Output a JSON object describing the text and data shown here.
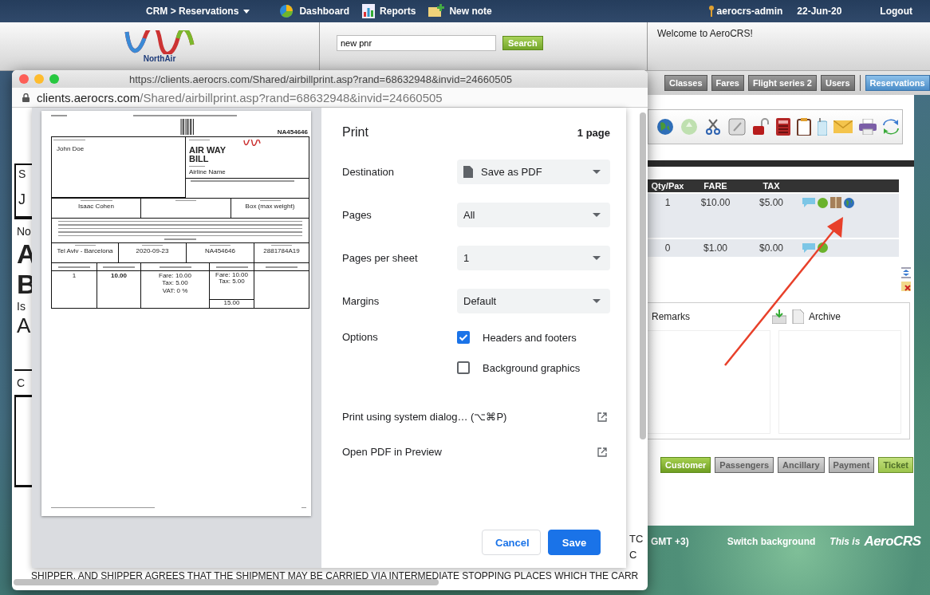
{
  "top_bar": {
    "menu": "CRM > Reservations",
    "links": [
      {
        "label": "Dashboard",
        "kind": "dashboard"
      },
      {
        "label": "Reports",
        "kind": "reports"
      },
      {
        "label": "New note",
        "kind": "note"
      }
    ],
    "user": "aerocrs-admin",
    "date": "22-Jun-20",
    "logout": "Logout"
  },
  "header": {
    "logo": "NorthAir",
    "search": {
      "value": "new pnr",
      "button": "Search"
    },
    "welcome": "Welcome to AeroCRS!"
  },
  "app": {
    "nav_tabs": [
      {
        "label": "Classes",
        "selected": false
      },
      {
        "label": "Fares",
        "selected": false
      },
      {
        "label": "Flight series 2",
        "selected": false
      },
      {
        "label": "Users",
        "selected": false
      },
      {
        "label": "Reservations",
        "selected": true
      }
    ],
    "table": {
      "columns": [
        "Qty/Pax",
        "FARE",
        "TAX"
      ],
      "rows": [
        {
          "kind": "cargo",
          "cells": [
            "1",
            "$10.00",
            "$5.00"
          ]
        },
        {
          "kind": "plain",
          "cells": [
            "0",
            "$1.00",
            "$0.00"
          ]
        }
      ]
    },
    "remarks": "Remarks",
    "archive": "Archive",
    "steps": [
      {
        "label": "Customer",
        "active": true,
        "disabled": false
      },
      {
        "label": "Passengers",
        "active": false,
        "disabled": true
      },
      {
        "label": "Ancillary",
        "active": false,
        "disabled": true
      },
      {
        "label": "Payment",
        "active": false,
        "disabled": true
      },
      {
        "label": "Ticket",
        "active": false,
        "disabled": false
      }
    ],
    "footer": {
      "timezone": "GMT +3)",
      "switch": "Switch background",
      "brand_prefix": "This is",
      "brand": "AeroCRS"
    }
  },
  "browser": {
    "title": "https://clients.aerocrs.com/Shared/airbillprint.asp?rand=68632948&invid=24660505",
    "address_host": "clients.aerocrs.com",
    "address_path": "/Shared/airbillprint.asp?rand=68632948&invid=24660505",
    "behind_page": {
      "left_fragments": [
        {
          "text": "S",
          "kind": "small"
        },
        {
          "text": "J",
          "kind": "text"
        },
        {
          "text": "No",
          "kind": "small"
        },
        {
          "text": "A",
          "kind": "heading"
        },
        {
          "text": "B",
          "kind": "heading"
        },
        {
          "text": "Is",
          "kind": "small"
        },
        {
          "text": "A",
          "kind": "large"
        },
        {
          "text": "C",
          "kind": "small"
        }
      ],
      "right_fragments": [
        "TC",
        "C"
      ],
      "bottom_line": "SHIPPER, AND SHIPPER AGREES THAT THE SHIPMENT MAY BE CARRIED VIA INTERMEDIATE STOPPING PLACES WHICH THE CARR"
    }
  },
  "print_dialog": {
    "title": "Print",
    "page_count": "1 page",
    "settings": [
      {
        "label": "Destination",
        "kind": "destination",
        "value": "Save as PDF"
      },
      {
        "label": "Pages",
        "kind": "select",
        "value": "All"
      },
      {
        "label": "Pages per sheet",
        "kind": "select",
        "value": "1"
      },
      {
        "label": "Margins",
        "kind": "select",
        "value": "Default"
      }
    ],
    "options_label": "Options",
    "options": [
      {
        "label": "Headers and footers",
        "checked": true
      },
      {
        "label": "Background graphics",
        "checked": false
      }
    ],
    "links": [
      "Print using system dialog… (⌥⌘P)",
      "Open PDF in Preview"
    ],
    "cancel": "Cancel",
    "save": "Save",
    "preview": {
      "number": "NA454646",
      "shipper": "John Doe",
      "title": "AIR WAY BILL",
      "airline": "Airline Name",
      "consignee": "Isaac Cohen",
      "package_type": "Box (max weight)",
      "route": [
        "Tel Aviv - Barcelona",
        "2020-09-23",
        "NA454646",
        "2881784A19"
      ],
      "pieces": "1",
      "weight": "10.00",
      "rate": [
        "Fare: 10.00",
        "Tax: 5.00",
        "VAT: 0 %"
      ],
      "total": [
        "Fare: 10.00",
        "Tax: 5.00"
      ],
      "total_sum": "15.00"
    }
  }
}
